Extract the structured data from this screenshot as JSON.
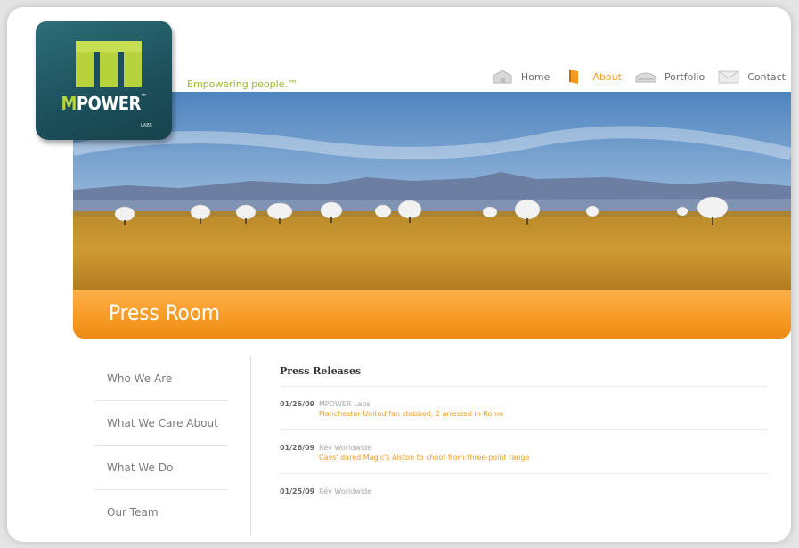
{
  "logo": {
    "brand_prefix": "M",
    "brand_rest": "POWER",
    "trademark": "™",
    "sub": "LABS"
  },
  "tagline": "Empowering people.™",
  "nav": [
    {
      "label": "Home",
      "icon": "house-icon",
      "active": false
    },
    {
      "label": "About",
      "icon": "book-icon",
      "active": true
    },
    {
      "label": "Portfolio",
      "icon": "portfolio-icon",
      "active": false
    },
    {
      "label": "Contact",
      "icon": "envelope-icon",
      "active": false
    }
  ],
  "banner": {
    "title": "Press Room"
  },
  "sidenav": [
    "Who We Are",
    "What We Care About",
    "What We Do",
    "Our Team"
  ],
  "press": {
    "title": "Press Releases",
    "items": [
      {
        "date": "01/26/09",
        "source": "MPOWER Labs",
        "headline": "Manchester United fan stabbed, 2 arrested in Rome"
      },
      {
        "date": "01/26/09",
        "source": "Rév Worldwide",
        "headline": "Cavs' dared Magic's Alston to shoot from three-point range"
      },
      {
        "date": "01/25/09",
        "source": "Rév Worldwide",
        "headline": ""
      }
    ]
  },
  "colors": {
    "accent": "#f39a1f",
    "logo_bg": "#1c4f5a",
    "tagline": "#9bb533"
  }
}
